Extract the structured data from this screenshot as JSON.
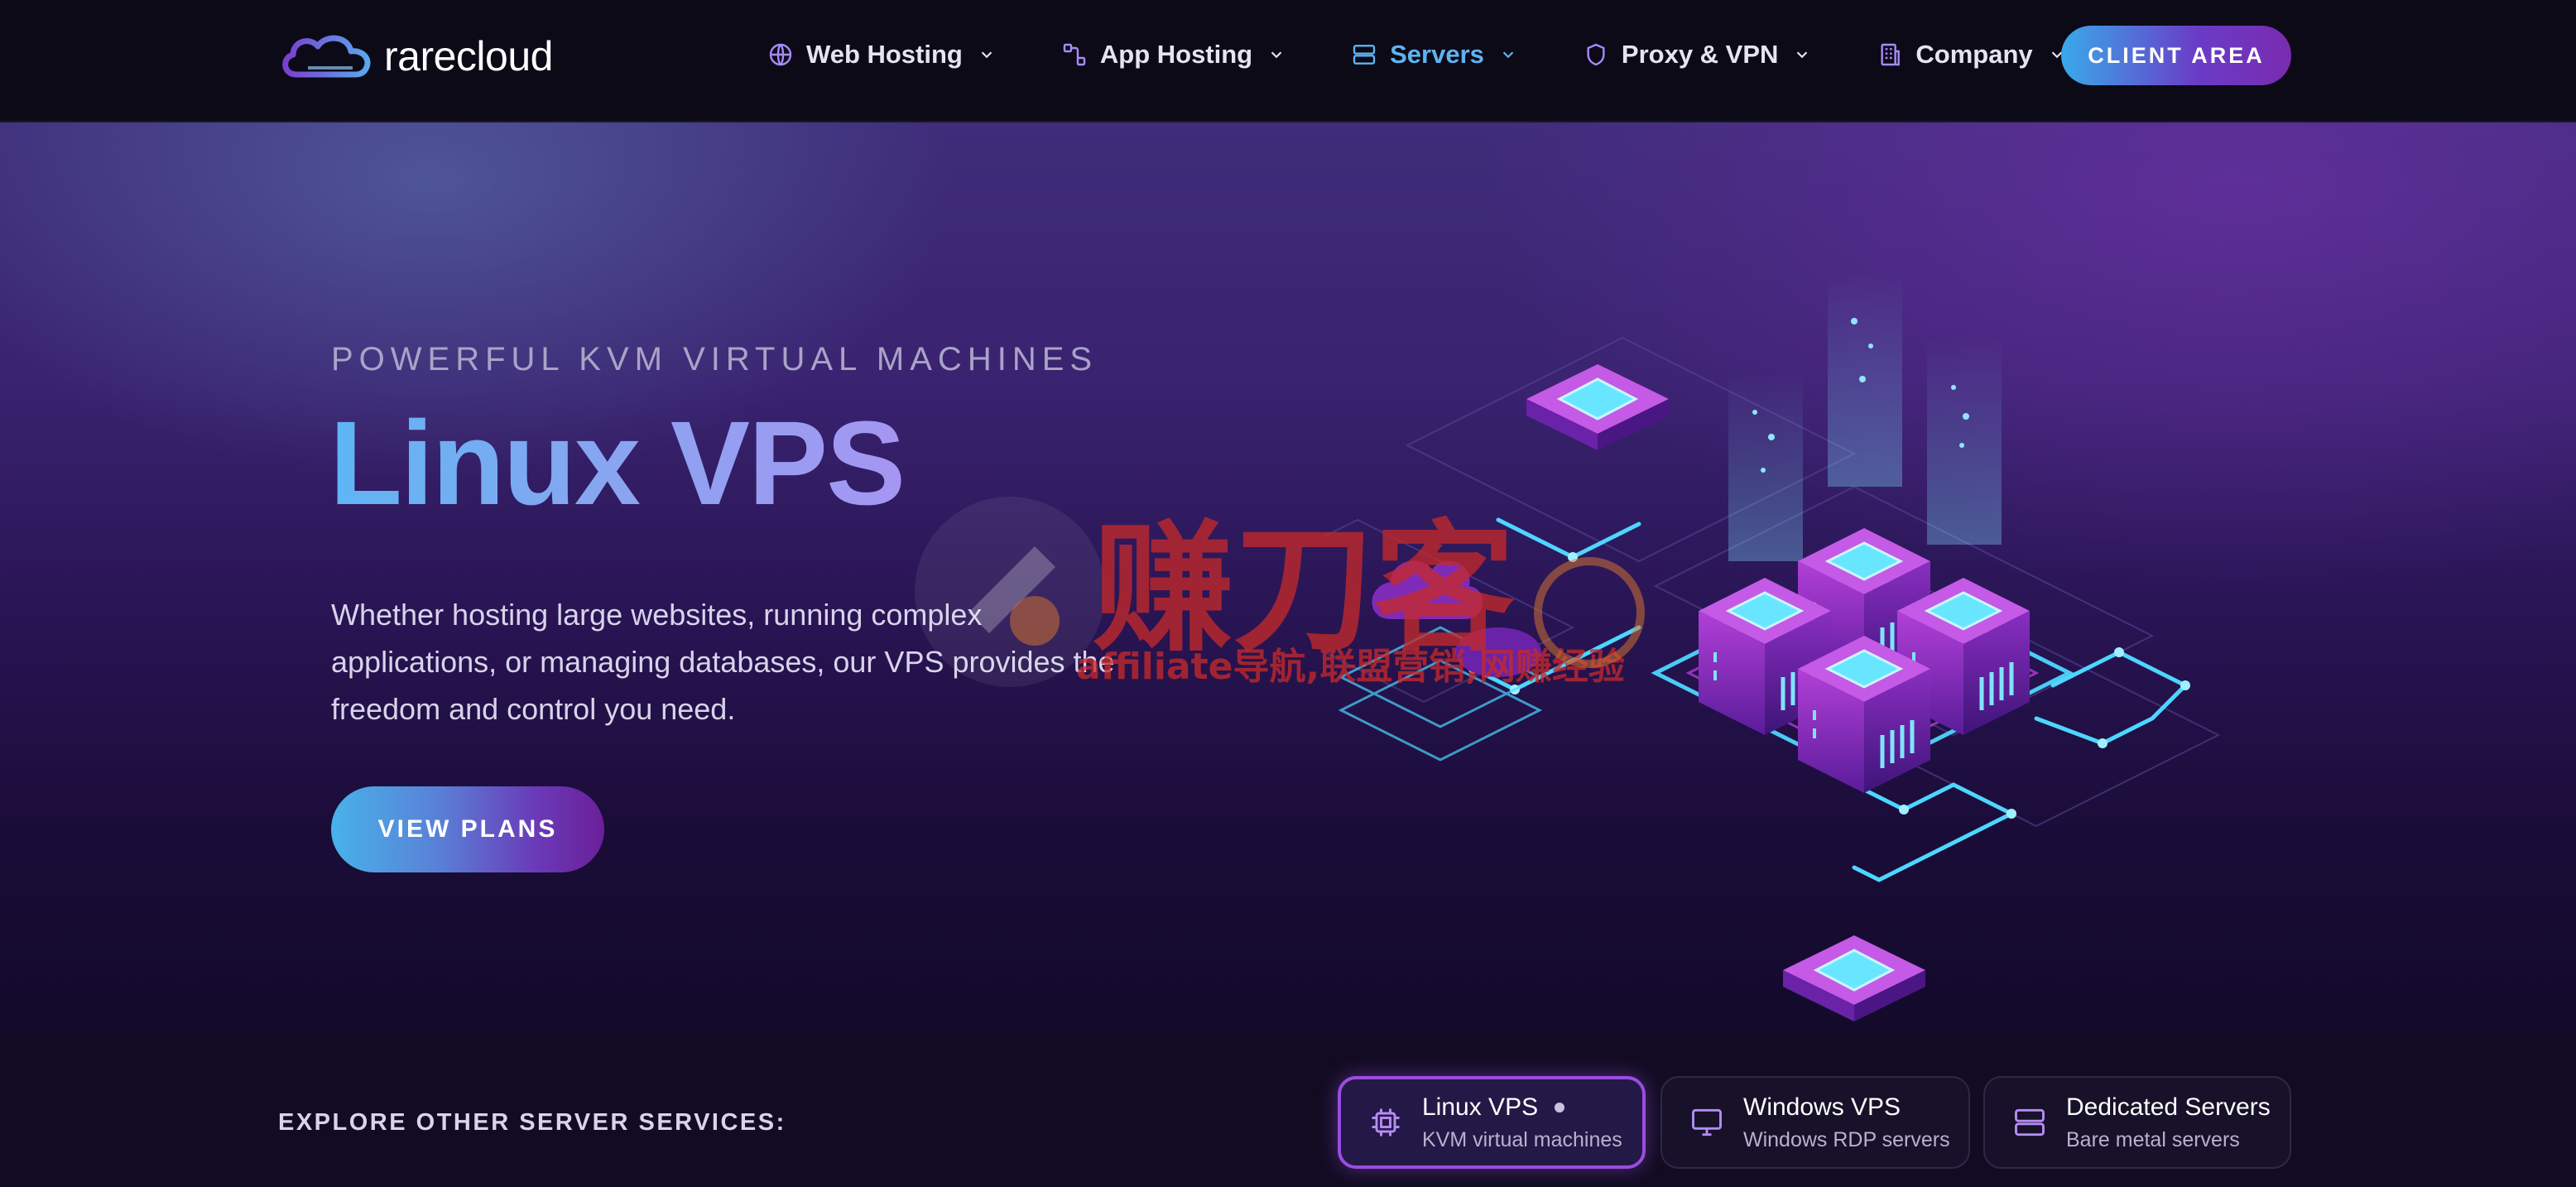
{
  "brand": {
    "name": "rarecloud"
  },
  "nav": {
    "items": [
      {
        "label": "Web Hosting",
        "icon": "globe-icon",
        "active": false
      },
      {
        "label": "App Hosting",
        "icon": "nodes-icon",
        "active": false
      },
      {
        "label": "Servers",
        "icon": "server-icon",
        "active": true
      },
      {
        "label": "Proxy & VPN",
        "icon": "shield-icon",
        "active": false
      },
      {
        "label": "Company",
        "icon": "building-icon",
        "active": false
      }
    ],
    "cta": "CLIENT AREA"
  },
  "hero": {
    "eyebrow": "POWERFUL KVM VIRTUAL MACHINES",
    "title": "Linux VPS",
    "description": "Whether hosting large websites, running complex applications, or managing databases, our VPS provides the freedom and control you need.",
    "button": "VIEW PLANS"
  },
  "watermark": {
    "main": "赚刀客",
    "sub": "affiliate导航,联盟营销,网赚经验"
  },
  "services": {
    "label": "EXPLORE OTHER SERVER SERVICES:",
    "cards": [
      {
        "title": "Linux VPS",
        "subtitle": "KVM virtual machines",
        "icon": "cpu-chip-icon",
        "active": true
      },
      {
        "title": "Windows VPS",
        "subtitle": "Windows RDP servers",
        "icon": "monitor-icon",
        "active": false
      },
      {
        "title": "Dedicated Servers",
        "subtitle": "Bare metal servers",
        "icon": "server-stack-icon",
        "active": false
      }
    ]
  },
  "colors": {
    "accent_blue": "#5fb3f0",
    "accent_purple": "#9a4de0",
    "background": "#0c0918"
  }
}
